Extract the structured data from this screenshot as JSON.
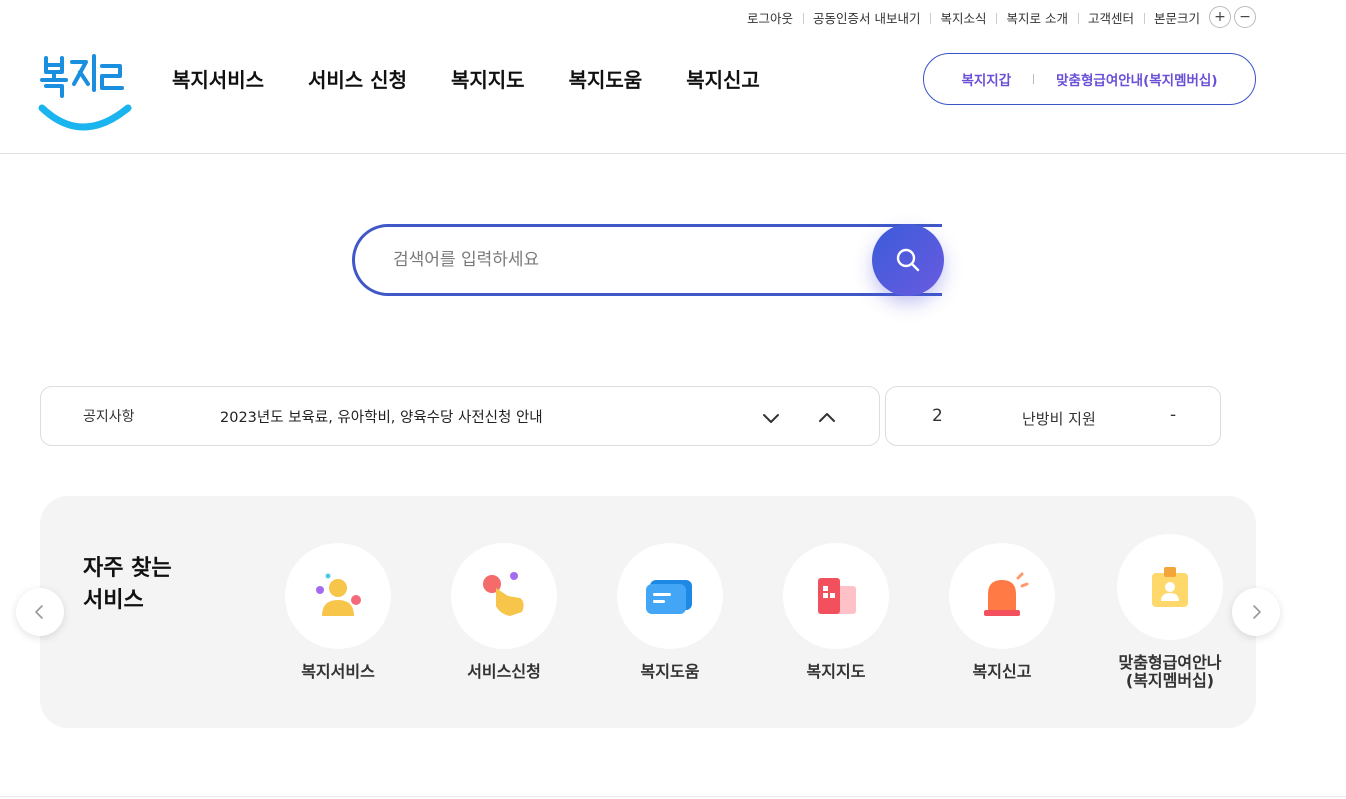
{
  "utility": {
    "logout": "로그아웃",
    "cert_export": "공동인증서 내보내기",
    "news": "복지소식",
    "about": "복지로 소개",
    "support": "고객센터",
    "font_size": "본문크기",
    "font_plus": "+",
    "font_minus": "−"
  },
  "nav": {
    "items": [
      "복지서비스",
      "서비스 신청",
      "복지지도",
      "복지도움",
      "복지신고"
    ]
  },
  "header_cta": {
    "wallet": "복지지갑",
    "membership": "맞춤형급여안내(복지멤버십)"
  },
  "search": {
    "placeholder": "검색어를 입력하세요"
  },
  "notice": {
    "label": "공지사항",
    "text": "2023년도 보육료, 유아학비, 양육수당 사전신청 안내"
  },
  "ranking": {
    "number": "2",
    "keyword": "난방비 지원",
    "change": "-"
  },
  "quick": {
    "title_line1": "자주 찾는",
    "title_line2": "서비스",
    "items": [
      {
        "label": "복지서비스",
        "icon": "person-icon"
      },
      {
        "label": "서비스신청",
        "icon": "hand-click-icon"
      },
      {
        "label": "복지도움",
        "icon": "chat-bubble-icon"
      },
      {
        "label": "복지지도",
        "icon": "map-building-icon"
      },
      {
        "label": "복지신고",
        "icon": "siren-icon"
      },
      {
        "label": "맞춤형급여안나\n(복지멤버십)",
        "icon": "id-badge-icon"
      }
    ]
  },
  "colors": {
    "brand_blue": "#3f58c8",
    "brand_purple": "#6b4fd8",
    "quick_bg": "#f4f4f4"
  }
}
